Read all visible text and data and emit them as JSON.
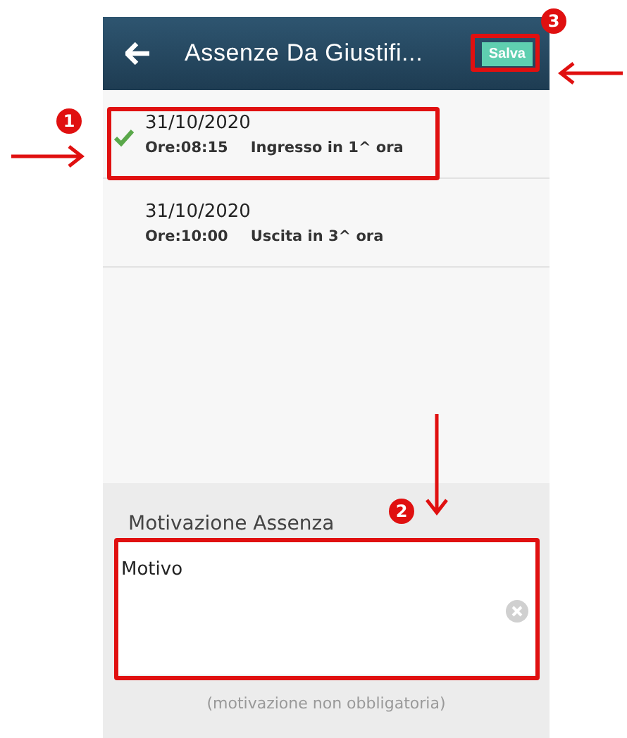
{
  "header": {
    "title": "Assenze Da Giustifi...",
    "save_button": "Salva"
  },
  "absences": [
    {
      "date": "31/10/2020",
      "time": "Ore:08:15",
      "description": "Ingresso in 1^ ora",
      "selected": true
    },
    {
      "date": "31/10/2020",
      "time": "Ore:10:00",
      "description": "Uscita in 3^ ora",
      "selected": false
    }
  ],
  "reason": {
    "label": "Motivazione Assenza",
    "value": "Motivo",
    "hint": "(motivazione non obbligatoria)"
  },
  "annotations": [
    {
      "number": "1",
      "kind": "row"
    },
    {
      "number": "2",
      "kind": "field"
    },
    {
      "number": "3",
      "kind": "save"
    }
  ]
}
